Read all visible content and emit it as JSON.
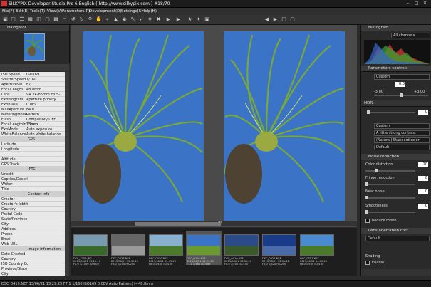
{
  "window": {
    "title": "SILKYPIX Developer Studio Pro 6 English ( http://www.silkypix.com )  #18/70"
  },
  "menu": [
    "File(F)",
    "Edit(E)",
    "Tools(T)",
    "View(V)",
    "Parameters(P)",
    "Development(D)",
    "Settings(S)",
    "Help(H)"
  ],
  "navigator": {
    "title": "Navigator"
  },
  "exif_rows": [
    {
      "k": "ISO Speed",
      "v": "ISO169"
    },
    {
      "k": "ShutterSpeed",
      "v": "1/160"
    },
    {
      "k": "ApertureVal",
      "v": "F7.1"
    },
    {
      "k": "FocalLength",
      "v": "48.8mm"
    },
    {
      "k": "Lens",
      "v": "VR 24-85mm F3.5-"
    },
    {
      "k": "ExpProgram",
      "v": "Aperture priority"
    },
    {
      "k": "ExpBiase",
      "v": "0.0EV"
    },
    {
      "k": "MaxAperture",
      "v": "F4.0"
    },
    {
      "k": "MeteringMode",
      "v": "Pattern"
    },
    {
      "k": "Flash",
      "v": "Compulsory OFF"
    },
    {
      "k": "FocalLengthIn35mm",
      "v": "73mm"
    },
    {
      "k": "ExpMode",
      "v": "Auto exposure"
    },
    {
      "k": "WhiteBalance",
      "v": "Auto white balance"
    },
    {
      "k": "GPS",
      "v": "",
      "sect": true
    },
    {
      "k": "Latitude",
      "v": ""
    },
    {
      "k": "Longitude",
      "v": ""
    },
    {
      "k": "",
      "v": ""
    },
    {
      "k": "Altitude",
      "v": ""
    },
    {
      "k": "GPS Track",
      "v": ""
    },
    {
      "k": "IPTC",
      "v": "",
      "sect": true
    },
    {
      "k": "Unedit",
      "v": ""
    },
    {
      "k": "Caption/Descri",
      "v": ""
    },
    {
      "k": "Writer",
      "v": ""
    },
    {
      "k": "Title",
      "v": ""
    },
    {
      "k": "Contact info",
      "v": "",
      "sect": true
    },
    {
      "k": "Creator",
      "v": ""
    },
    {
      "k": "Creator's Jobtit",
      "v": ""
    },
    {
      "k": "Country",
      "v": ""
    },
    {
      "k": "Postal Code",
      "v": ""
    },
    {
      "k": "State/Province",
      "v": ""
    },
    {
      "k": "City",
      "v": ""
    },
    {
      "k": "Address",
      "v": ""
    },
    {
      "k": "Phone",
      "v": ""
    },
    {
      "k": "Email",
      "v": ""
    },
    {
      "k": "Web URL",
      "v": ""
    },
    {
      "k": "Image information",
      "v": "",
      "sect": true
    },
    {
      "k": "Date Created",
      "v": ""
    },
    {
      "k": "Country",
      "v": ""
    },
    {
      "k": "ISO Country Co",
      "v": ""
    },
    {
      "k": "Province/State",
      "v": ""
    },
    {
      "k": "City",
      "v": ""
    }
  ],
  "viewer": {
    "zoom": "73"
  },
  "thumbnails": [
    {
      "name": "DSC_7759.JPG",
      "l2": "2013/06/21 13:29:10",
      "l3": "F8.0 1/1000 ISO800"
    },
    {
      "name": "DSC_0836.NEF",
      "l2": "2013/06/21 13:42:12",
      "l3": "F8.0 1/250 ISO200"
    },
    {
      "name": "DSC_0410.NEF",
      "l2": "2013/06/21 13:43:25",
      "l3": "F8.0 1/400 ISO100"
    },
    {
      "name": "DSC_0419.NEF",
      "l2": "2013/06/21 13:29:25",
      "l3": "F7.1 1/160 ISO169",
      "selected": true
    },
    {
      "name": "DSC_0420.NEF",
      "l2": "2013/06/21 13:30:40",
      "l3": "F8.0 1/200 ISO100"
    },
    {
      "name": "DSC_0421.NEF",
      "l2": "2013/06/21 13:51:12",
      "l3": "F8.0 1/320 ISO200"
    },
    {
      "name": "DSC_0557.NEF",
      "l2": "2013/06/21 14:00:45",
      "l3": "F8.0 1/500 ISO100"
    }
  ],
  "right": {
    "histogram": "Histogram",
    "all_channels": "All channels",
    "params": "Parameters controls",
    "custom1": "Custom",
    "exp_val": "0.0",
    "min": "-3.00",
    "max": "+3.00",
    "hdr": "HDR",
    "hdr_val": "0",
    "custom2": "Custom",
    "contrast": "A little strong contrast",
    "color": "(Natural) Standard color",
    "default1": "Default",
    "noise": "Noise reduction",
    "color_distortion": "Color distortion",
    "cd_val": "20",
    "fringe": "Fringe reduction",
    "fr_val": "0",
    "neat_noise": "Neat noise",
    "nn_val": "0",
    "smoothness": "Smoothness",
    "sm_val": "0",
    "reduce_moire": "Reduce moire",
    "lens": "Lens aberration corr.",
    "default2": "Default",
    "shading": "Shading",
    "enable": "Enable"
  },
  "status": "DSC_0419.NEF 13/06/21 13:29:25 F7.1 1/160 ISO169 0.0EV Auto(Pattern) f=48.8mm"
}
